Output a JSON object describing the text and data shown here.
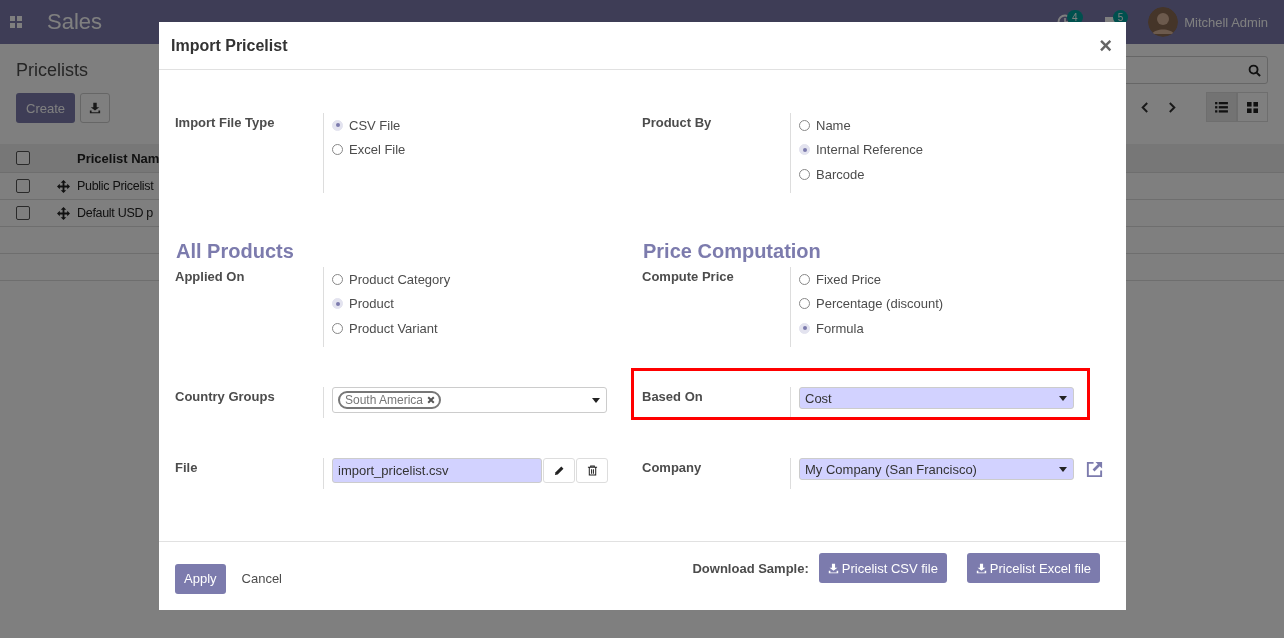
{
  "navbar": {
    "app": "Sales",
    "activity_count": "4",
    "message_count": "5",
    "user": "Mitchell Admin"
  },
  "page": {
    "title": "Pricelists",
    "create_button": "Create",
    "views": [
      {
        "kind": "list",
        "selected": true
      },
      {
        "kind": "kanban",
        "selected": false
      }
    ],
    "table": {
      "column": "Pricelist Nam",
      "header_checked": false,
      "rows": [
        {
          "name": "Public Pricelist",
          "checked": false
        },
        {
          "name": "Default USD p",
          "checked": false
        }
      ]
    }
  },
  "dialog": {
    "title": "Import Pricelist",
    "close": "×",
    "rows": [
      [
        {
          "kind": "radio",
          "label": "Import File Type",
          "options": [
            {
              "label": "CSV File",
              "selected": true
            },
            {
              "label": "Excel File",
              "selected": false
            }
          ]
        },
        {
          "kind": "radio",
          "label": "Product By",
          "options": [
            {
              "label": "Name",
              "selected": false
            },
            {
              "label": "Internal Reference",
              "selected": true
            },
            {
              "label": "Barcode",
              "selected": false
            }
          ]
        }
      ],
      [
        {
          "kind": "heading",
          "text": "All Products"
        },
        {
          "kind": "heading",
          "text": "Price Computation"
        }
      ],
      [
        {
          "kind": "radio",
          "label": "Applied On",
          "options": [
            {
              "label": "Product Category",
              "selected": false
            },
            {
              "label": "Product",
              "selected": true
            },
            {
              "label": "Product Variant",
              "selected": false
            }
          ]
        },
        {
          "kind": "radio",
          "label": "Compute Price",
          "options": [
            {
              "label": "Fixed Price",
              "selected": false
            },
            {
              "label": "Percentage (discount)",
              "selected": false
            },
            {
              "label": "Formula",
              "selected": true
            }
          ]
        }
      ],
      [
        {
          "kind": "tags",
          "label": "Country Groups",
          "tags": [
            "South America"
          ]
        },
        {
          "kind": "select",
          "label": "Based On",
          "value": "Cost",
          "highlighted": true,
          "external_link": false
        }
      ],
      [
        {
          "kind": "file",
          "label": "File",
          "value": "import_pricelist.csv"
        },
        {
          "kind": "select",
          "label": "Company",
          "value": "My Company (San Francisco)",
          "highlighted": false,
          "external_link": true
        }
      ]
    ],
    "apply_button": "Apply",
    "cancel_button": "Cancel",
    "download_label": "Download Sample:",
    "download_buttons": [
      "Pricelist CSV file",
      "Pricelist Excel file"
    ]
  }
}
